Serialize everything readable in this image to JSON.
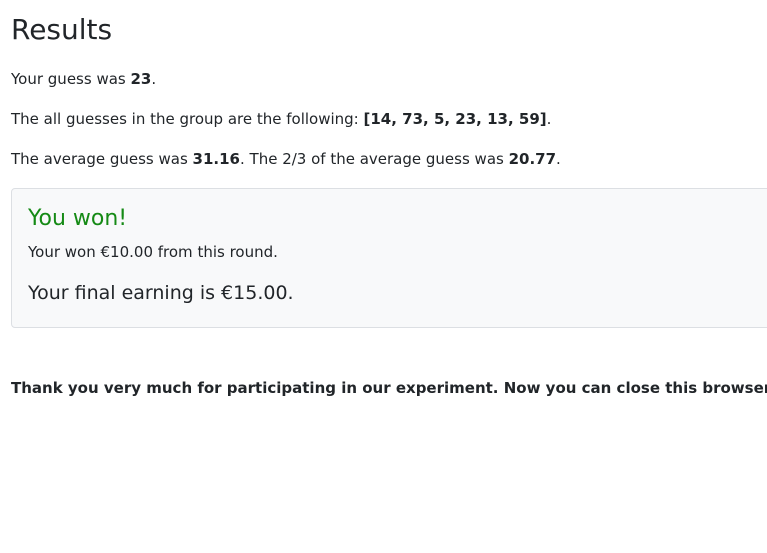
{
  "page": {
    "title": "Results"
  },
  "guess": {
    "prefix": "Your guess was ",
    "value": "23",
    "suffix": "."
  },
  "group": {
    "prefix": "The all guesses in the group are the following: ",
    "values": "[14, 73, 5, 23, 13, 59]",
    "suffix": "."
  },
  "average": {
    "prefix": "The average guess was ",
    "value": "31.16",
    "middle": ". The 2/3 of the average guess was ",
    "two_thirds": "20.77",
    "suffix": "."
  },
  "result_card": {
    "title": "You won!",
    "round_winnings": "Your won €10.00 from this round.",
    "final_earning": "Your final earning is €15.00."
  },
  "thanks": "Thank you very much for participating in our experiment. Now you can close this browser.",
  "colors": {
    "won_title": "#158a15",
    "card_background": "#f8f9fa",
    "text": "#212529"
  }
}
